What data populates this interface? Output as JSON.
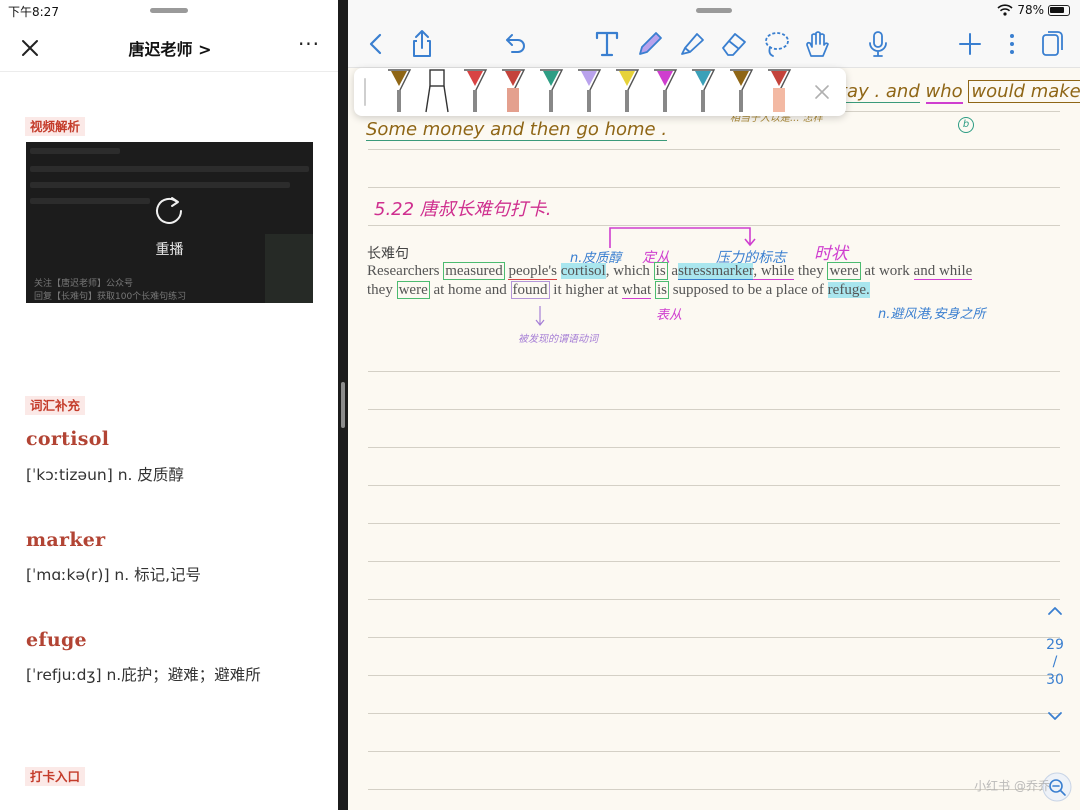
{
  "left": {
    "status_time": "下午8:27",
    "nav_title": "唐迟老师 >",
    "more_label": "···",
    "video_section_label": "视频解析",
    "video": {
      "replay_label": "重播",
      "lines": [
        "关注【唐迟老师】公众号",
        "回复【长难句】获取100个长难句练习"
      ]
    },
    "vocab_section_label": "词汇补充",
    "vocab": [
      {
        "word": "cortisol",
        "definition": "[ˈkɔːtizəun] n. 皮质醇"
      },
      {
        "word": "marker",
        "definition": "[ˈmɑːkə(r)] n. 标记,记号"
      },
      {
        "word": "efuge",
        "definition": "[ˈrefjuːdʒ] n.庇护；避难；避难所"
      }
    ],
    "checkin_section_label": "打卡入口"
  },
  "right": {
    "status_wifi": "78%",
    "top_line": {
      "part1": "tay . and",
      "who": "who",
      "would_make": "would make"
    },
    "line2": "Some money and then go home .",
    "small_note": "相当于人以是... 怎样",
    "circle_mark": "b",
    "date_title": "5.22 唐叔长难句打卡.",
    "section_label": "长难句",
    "annotations": {
      "n_mark": "n.皮质醇",
      "attr_mark": "定从",
      "stress_mark": "压力的标志",
      "time_mark": "时状",
      "pred_mark": "表从",
      "refuge_mark": "n.避风港,安身之所",
      "found_note": "被发现的谓语动词"
    },
    "sentence_1": {
      "w1": "Researchers",
      "w2": "measured",
      "w3": "people's",
      "w4": "cortisol",
      "w5": ", which",
      "w6": "is",
      "w7": "a",
      "w8": "stress",
      "w9": "marker",
      "w10": ", while",
      "w11": "they",
      "w12": "were",
      "w13": "at work",
      "w14": "and while"
    },
    "sentence_2": {
      "w1": "they",
      "w2": "were",
      "w3": "at home and",
      "w4": "found",
      "w5": "it higher at",
      "w6": "what",
      "w7": "is",
      "w8": "supposed to be a place of",
      "w9": "refuge."
    },
    "page_current": "29",
    "page_sep": "/",
    "page_total": "30",
    "watermark": "小红书 @乔乔"
  },
  "colors": {
    "accent_red": "#b24434",
    "tag_bg": "#fbe9e7",
    "app_blue": "#3a7fd0",
    "ink_brown": "#8f6616",
    "ink_magenta": "#cf3ecf",
    "ink_blue": "#3a7fd0",
    "ink_purple": "#a67fd6",
    "highlight": "#a9e6ee",
    "paper": "#fcf9f2"
  },
  "icons": [
    "close-icon",
    "more-icon",
    "replay-icon",
    "back-icon",
    "share-icon",
    "undo-icon",
    "text-tool-icon",
    "pen-icon",
    "highlighter-icon",
    "eraser-icon",
    "lasso-icon",
    "hand-icon",
    "mic-icon",
    "add-icon",
    "more-vertical-icon",
    "pages-icon",
    "close-palette-icon",
    "chevron-up-icon",
    "chevron-down-icon",
    "zoom-icon"
  ]
}
